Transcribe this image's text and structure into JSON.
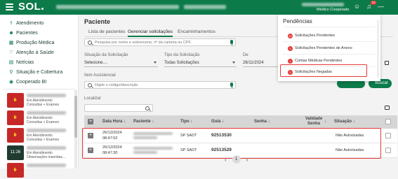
{
  "header": {
    "logo": "SOL",
    "user_role": "Médico Cooperado",
    "notif_count": "10"
  },
  "sidebar": {
    "items": [
      {
        "label": "Atendimento",
        "icon": "stethoscope-icon"
      },
      {
        "label": "Pacientes",
        "icon": "users-icon"
      },
      {
        "label": "Produção Médica",
        "icon": "chart-icon"
      },
      {
        "label": "Atenção à Saúde",
        "icon": "heart-icon"
      },
      {
        "label": "Notícias",
        "icon": "news-icon"
      },
      {
        "label": "Situação e Cobertura",
        "icon": "search-icon"
      },
      {
        "label": "Cooperado BI",
        "icon": "bi-icon"
      }
    ],
    "chats": [
      {
        "avatar": "",
        "caption": "Em Atendimento",
        "caption2": "Consultas + Exames"
      },
      {
        "avatar": "",
        "caption": "Em Atendimento",
        "caption2": "Consultas + Exames"
      },
      {
        "avatar": "",
        "caption": "Em Atendimento",
        "caption2": "Consultas + Exames"
      },
      {
        "avatar": "11:26",
        "caption": "Em Atendimento",
        "caption2": "Observações inseridas..."
      },
      {
        "avatar": "",
        "caption": "",
        "caption2": ""
      }
    ]
  },
  "main": {
    "title": "Paciente",
    "tabs": [
      "Lista de pacientes",
      "Gerenciar solicitações",
      "Encaminhamentos"
    ],
    "search_placeholder": "Pesquise por nome e sobrenome, nº da carteira ou CPF.",
    "filters": {
      "situacao_label": "Situação da Solicitação",
      "situacao_value": "Selecione....",
      "tipo_label": "Tipo da Solicitação",
      "tipo_value": "Todas Solicitações",
      "de_label": "De",
      "de_value": "26/11/2024",
      "item_label": "Item Assistencial",
      "item_placeholder": "Digite o código/descrição",
      "localizar_label": "Localizar",
      "buscar_label": "Buscar"
    },
    "table": {
      "headers": [
        "Data Hora",
        "Paciente",
        "Tipo",
        "Guia",
        "Senha",
        "Validade Senha",
        "Situação"
      ],
      "rows": [
        {
          "date": "26/12/2024",
          "time": "08:47:52",
          "tipo": "SP SADT",
          "guia": "92513530",
          "senha": "",
          "validade": "",
          "situacao": "Não Autorizadas"
        },
        {
          "date": "26/12/2024",
          "time": "08:47:30",
          "tipo": "SP SADT",
          "guia": "92513529",
          "senha": "",
          "validade": "",
          "situacao": "Não Autorizadas"
        }
      ]
    },
    "pager": {
      "current": "1"
    }
  },
  "notifications": {
    "title": "Pendências",
    "items": [
      {
        "count": "10",
        "label": "Solicitações Pendentes"
      },
      {
        "count": "0",
        "label": "Solicitações Pendentes de Anexo"
      },
      {
        "count": "1",
        "label": "Contas Médicas Pendentes"
      },
      {
        "count": "2",
        "label": "Solicitações Negadas"
      }
    ]
  },
  "colors": {
    "brand": "#0d7a4a",
    "alert": "#e53935"
  }
}
